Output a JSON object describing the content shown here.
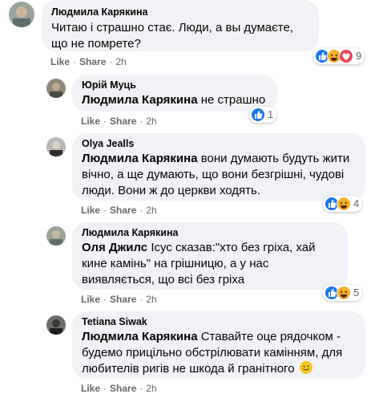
{
  "comments": [
    {
      "author": "Людмила Карякина",
      "text": "Читаю і страшно стає. Люди, а вы думаєте, що не помрете?",
      "like": "Like",
      "reply": "Share",
      "time": "2h",
      "reaction_count": "9",
      "reactions": [
        "like-icon",
        "haha-icon",
        "love-icon"
      ]
    },
    {
      "author": "Юрій Муць",
      "mention": "Людмила Карякина",
      "text": "не страшно",
      "like": "Like",
      "reply": "Share",
      "time": "2h",
      "reaction_count": "1",
      "reactions": [
        "like-icon"
      ]
    },
    {
      "author": "Olya Jealls",
      "mention": "Людмила Карякина",
      "text": "вони думають будуть жити вічно, а ще думають, що вони безгрішні, чудові люди. Вони ж до церкви ходять.",
      "like": "Like",
      "reply": "Share",
      "time": "2h",
      "reaction_count": "4",
      "reactions": [
        "like-icon",
        "haha-icon"
      ]
    },
    {
      "author": "Людмила Карякина",
      "mention": "Оля Джилс",
      "text": "Ісус сказав:\"хто без гріха, хай кине камінь\" на грішницю, а у нас виявляється, що всі без гріха",
      "like": "Like",
      "reply": "Share",
      "time": "2h",
      "reaction_count": "5",
      "reactions": [
        "like-icon",
        "haha-icon"
      ]
    },
    {
      "author": "Tetiana Siwak",
      "mention": "Людмила Карякина",
      "text": "Ставайте оце рядочком - будемо прицільно обстрілювати камінням, для любителів ригів не шкода й гранітного",
      "like": "Like",
      "reply": "Share",
      "time": "2h",
      "emoji": "slightly-smiling-face-emoji"
    }
  ],
  "colors": {
    "bubble": "#f0f2f5",
    "meta": "#65676b",
    "like": "#1877f2",
    "haha": "#f7b125",
    "love": "#f33e58"
  }
}
